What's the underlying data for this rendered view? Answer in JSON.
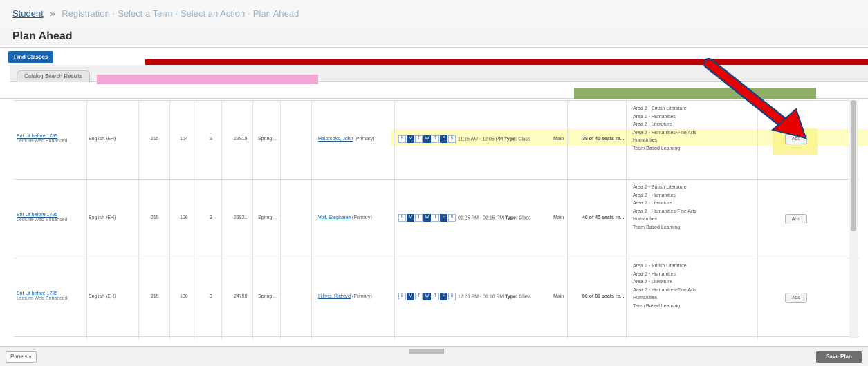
{
  "breadcrumb": {
    "root": "Student",
    "separator": "»",
    "rest": "Registration · Select a Term · Select an Action · Plan Ahead"
  },
  "page": {
    "title": "Plan Ahead"
  },
  "find_classes_label": "Find Classes",
  "tab_label": "Catalog Search Results",
  "rows": [
    {
      "title": "Brit Lit before 1785",
      "subtitle": "Lecture-Web Enhanced",
      "subject": "English (EH)",
      "course": "215",
      "section": "104",
      "hours": "3",
      "crn": "23919",
      "term": "Spring ...",
      "instructor": "Halbrooks, John",
      "instructor_role": "(Primary)",
      "days": [
        "S",
        "M",
        "T",
        "W",
        "T",
        "F",
        "S"
      ],
      "active_days": [
        false,
        true,
        false,
        true,
        false,
        true,
        false
      ],
      "time": "11:15 AM - 12:05 PM",
      "type_label": "Type:",
      "type_value": "Class",
      "campus": "Main",
      "seats": "39 of 40 seats re...",
      "attributes": [
        "Area 2 - British Literature",
        "Area 2 - Humanities",
        "Area 2 - Literature",
        "Area 2 - Humanities-Fine Arts",
        "Humanities",
        "Team Based Learning"
      ],
      "add_label": "Add"
    },
    {
      "title": "Brit Lit before 1785",
      "subtitle": "Lecture-Web Enhanced",
      "subject": "English (EH)",
      "course": "215",
      "section": "106",
      "hours": "3",
      "crn": "23921",
      "term": "Spring ...",
      "instructor": "Volf, Stephanie",
      "instructor_role": "(Primary)",
      "days": [
        "S",
        "M",
        "T",
        "W",
        "T",
        "F",
        "S"
      ],
      "active_days": [
        false,
        true,
        false,
        true,
        false,
        true,
        false
      ],
      "time": "01:25 PM - 02:15 PM",
      "type_label": "Type:",
      "type_value": "Class",
      "campus": "Main",
      "seats": "40 of 40 seats re...",
      "attributes": [
        "Area 2 - British Literature",
        "Area 2 - Humanities",
        "Area 2 - Literature",
        "Area 2 - Humanities-Fine Arts",
        "Humanities",
        "Team Based Learning"
      ],
      "add_label": "Add"
    },
    {
      "title": "Brit Lit before 1785",
      "subtitle": "Lecture-Web Enhanced",
      "subject": "English (EH)",
      "course": "215",
      "section": "108",
      "hours": "3",
      "crn": "24780",
      "term": "Spring ...",
      "instructor": "Hillyer, Richard",
      "instructor_role": "(Primary)",
      "days": [
        "S",
        "M",
        "T",
        "W",
        "T",
        "F",
        "S"
      ],
      "active_days": [
        false,
        true,
        false,
        true,
        false,
        true,
        false
      ],
      "time": "12:20 PM - 01:10 PM",
      "type_label": "Type:",
      "type_value": "Class",
      "campus": "Main",
      "seats": "80 of 80 seats re...",
      "attributes": [
        "Area 2 - British Literature",
        "Area 2 - Humanities",
        "Area 2 - Literature",
        "Area 2 - Humanities-Fine Arts",
        "Humanities",
        "Team Based Learning"
      ],
      "add_label": "Add"
    }
  ],
  "footer": {
    "panels_label": "Panels ▾",
    "save_label": "Save Plan"
  },
  "colors": {
    "accent_blue": "#1a64b4",
    "link_blue": "#1f5d99",
    "arrow_red": "#e60000",
    "highlight_yellow": "#fffbaa"
  }
}
